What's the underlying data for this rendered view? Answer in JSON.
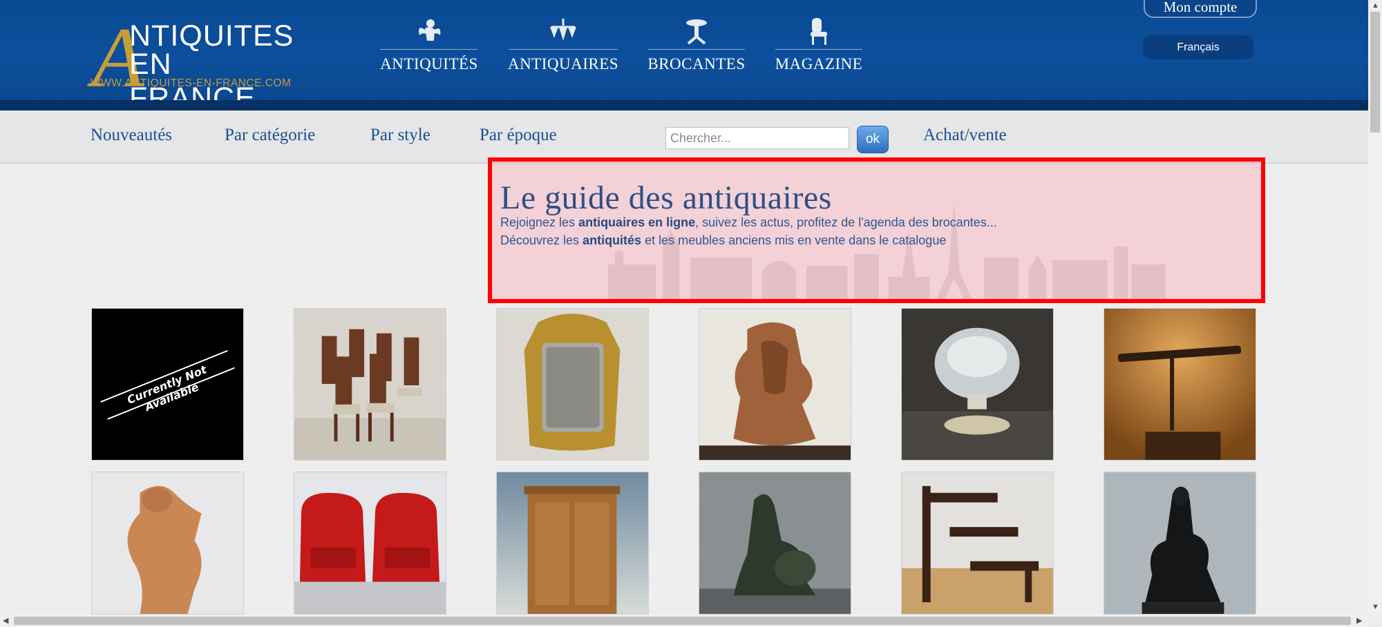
{
  "logo": {
    "letter": "A",
    "line1": "NTIQUITES",
    "line2": "EN FRANCE",
    "url": "WWW.ANTIQUITES-EN-FRANCE.COM"
  },
  "main_nav": [
    {
      "label": "ANTIQUITÉS",
      "icon": "cherub-icon"
    },
    {
      "label": "ANTIQUAIRES",
      "icon": "chandelier-icon"
    },
    {
      "label": "BROCANTES",
      "icon": "pedestal-table-icon"
    },
    {
      "label": "MAGAZINE",
      "icon": "chair-icon"
    }
  ],
  "account": {
    "label": "Mon compte",
    "language": "Français"
  },
  "subnav": {
    "links": [
      "Nouveautés",
      "Par catégorie",
      "Par style",
      "Par époque"
    ],
    "search_placeholder": "Chercher...",
    "search_button": "ok",
    "achat_vente": "Achat/vente"
  },
  "guide": {
    "title": "Le guide des antiquaires",
    "line1_pre": "Rejoignez les ",
    "line1_bold": "antiquaires en ligne",
    "line1_post": ", suivez les actus, profitez de l'agenda des brocantes...",
    "line2_pre": "Découvrez les ",
    "line2_bold": "antiquités",
    "line2_post": " et les meubles anciens mis en vente dans le catalogue"
  },
  "products": [
    {
      "name": "unavailable",
      "caption": "Currently Not Available"
    },
    {
      "name": "dining-chairs"
    },
    {
      "name": "gilt-mirror"
    },
    {
      "name": "carved-vase"
    },
    {
      "name": "crystal-bowl"
    },
    {
      "name": "telescope"
    },
    {
      "name": "terracotta-figure"
    },
    {
      "name": "red-club-armchairs"
    },
    {
      "name": "corner-cabinet"
    },
    {
      "name": "bronze-sculpture"
    },
    {
      "name": "library-steps"
    },
    {
      "name": "bronze-seated-figure"
    }
  ]
}
